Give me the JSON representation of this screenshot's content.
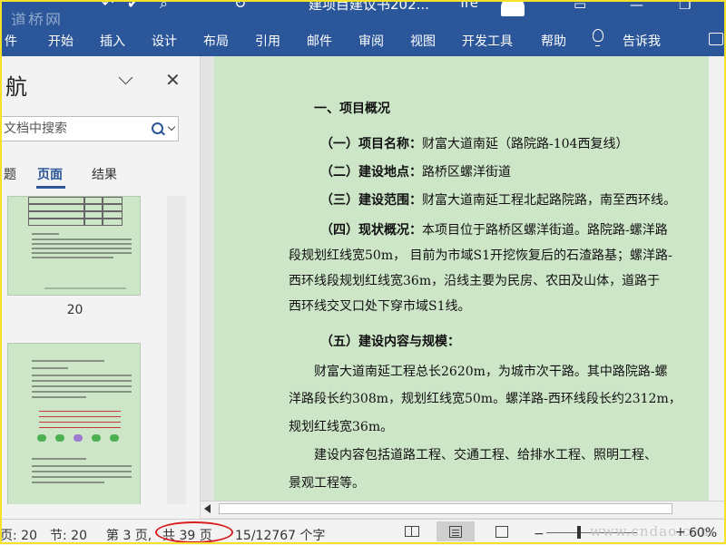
{
  "window": {
    "watermark": "道桥网",
    "title": "建项目建议书202...",
    "user": "Tre"
  },
  "ribbon": {
    "tabs": [
      "件",
      "开始",
      "插入",
      "设计",
      "布局",
      "引用",
      "邮件",
      "审阅",
      "视图",
      "开发工具",
      "帮助"
    ],
    "tell_me": "告诉我"
  },
  "nav": {
    "title": "航",
    "search_placeholder": "文档中搜索",
    "tabs": [
      {
        "label": "题",
        "active": false
      },
      {
        "label": "页面",
        "active": true
      },
      {
        "label": "结果",
        "active": false
      }
    ],
    "thumb_page_number": "20"
  },
  "document": {
    "lines": [
      {
        "text": "一、项目概况",
        "bold": true
      },
      {
        "label": "（一）项目名称：",
        "text": "财富大道南延（路院路-104西复线）"
      },
      {
        "label": "（二）建设地点：",
        "text": "路桥区螺洋街道"
      },
      {
        "label": "（三）建设范围：",
        "text": "财富大道南延工程北起路院路，南至西环线。"
      },
      {
        "label": "（四）现状概况：",
        "text": "本项目位于路桥区螺洋街道。路院路-螺洋路"
      },
      {
        "text": "段规划红线宽50m， 目前为市域S1开挖恢复后的石渣路基；螺洋路-"
      },
      {
        "text": "西环线段规划红线宽36m，沿线主要为民房、农田及山体，道路于"
      },
      {
        "text": "西环线交叉口处下穿市域S1线。"
      },
      {
        "text": "（五）建设内容与规模：",
        "bold": true
      },
      {
        "text": "财富大道南延工程总长2620m，为城市次干路。其中路院路-螺"
      },
      {
        "text": "洋路段长约308m，规划红线宽50m。螺洋路-西环线段长约2312m，"
      },
      {
        "text": "规划红线宽36m。"
      },
      {
        "text": "建设内容包括道路工程、交通工程、给排水工程、照明工程、"
      },
      {
        "text": "景观工程等。"
      }
    ]
  },
  "status": {
    "page": "页: 20",
    "section": "节: 20",
    "page_of": "第 3 页,",
    "total_pages": "共 39 页",
    "words": "15/12767 个字",
    "zoom_minus": "−",
    "zoom_plus": "+",
    "zoom": "60%",
    "watermark": "www.cndao.com"
  },
  "colors": {
    "ribbon": "#2b579a",
    "page": "#cde6c8",
    "highlight_circle": "#d81e1e",
    "frame": "#f5e02a"
  }
}
